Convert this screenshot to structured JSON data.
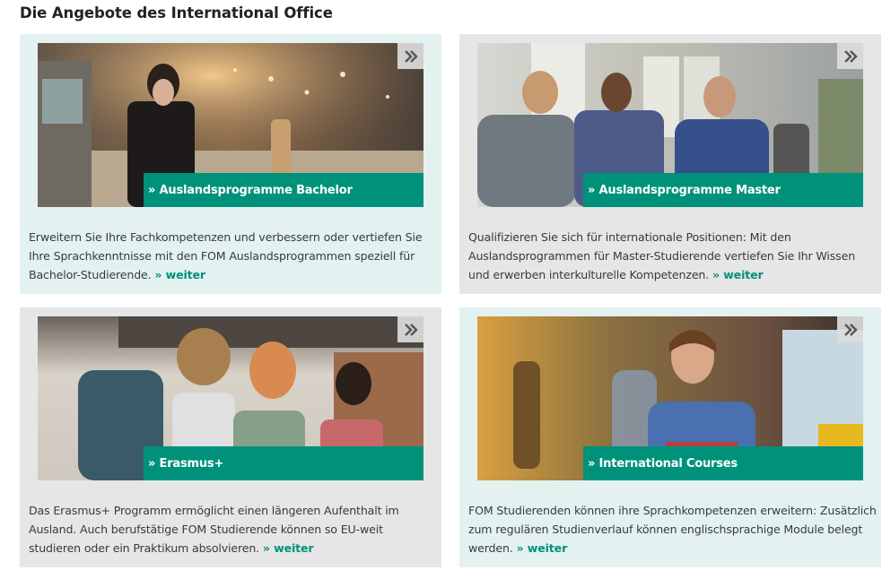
{
  "page": {
    "title": "Die Angebote des International Office"
  },
  "colors": {
    "accent": "#00917a",
    "card_mint": "#e3f2f1",
    "card_grey": "#e6e6e6"
  },
  "cards": [
    {
      "label": "» Auslandsprogramme Bachelor",
      "text": "Erweitern Sie Ihre Fachkompetenzen und verbessern oder vertiefen Sie Ihre Sprachkenntnisse mit den FOM Auslandsprogrammen speziell für Bachelor-Studierende.",
      "link": "» weiter",
      "arrow_icon": "double-chevron-right-icon"
    },
    {
      "label": "» Auslandsprogramme Master",
      "text": "Qualifizieren Sie sich für internationale Positionen: Mit den Auslandsprogrammen für Master-Studierende vertiefen Sie Ihr Wissen und erwerben interkulturelle Kompetenzen.",
      "link": "» weiter",
      "arrow_icon": "double-chevron-right-icon"
    },
    {
      "label": "» Erasmus+",
      "text": "Das Erasmus+ Programm ermöglicht einen längeren Aufenthalt im Ausland. Auch berufstätige FOM Studierende können so EU-weit studieren oder ein Praktikum absolvieren.",
      "link": "» weiter",
      "arrow_icon": "double-chevron-right-icon"
    },
    {
      "label": "» International Courses",
      "text": "FOM Studierenden können ihre Sprachkompetenzen erweitern: Zusätzlich zum regulären Studienverlauf können englischsprachige Module belegt werden.",
      "link": "» weiter",
      "arrow_icon": "double-chevron-right-icon"
    }
  ]
}
